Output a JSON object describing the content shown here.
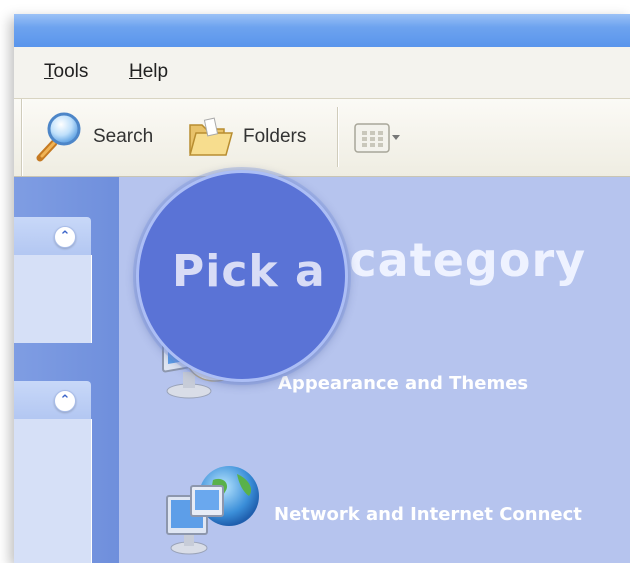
{
  "menubar": {
    "tools_label_u": "T",
    "tools_label_rest": "ools",
    "help_label_u": "H",
    "help_label_rest": "elp"
  },
  "toolbar": {
    "search_label": "Search",
    "folders_label": "Folders"
  },
  "main": {
    "title_visible": "Pick a category",
    "title_magnified": "Pick a",
    "categories": [
      {
        "label": "Appearance and Themes",
        "icon": "appearance-themes-icon"
      },
      {
        "label": "Network and Internet Connect",
        "icon": "network-internet-icon"
      }
    ]
  },
  "colors": {
    "main_bg": "#b6c4ee",
    "taskpane_bg": "#7f9de3",
    "title_bar": "#6da3ef",
    "magnifier": "#5a73d6"
  }
}
